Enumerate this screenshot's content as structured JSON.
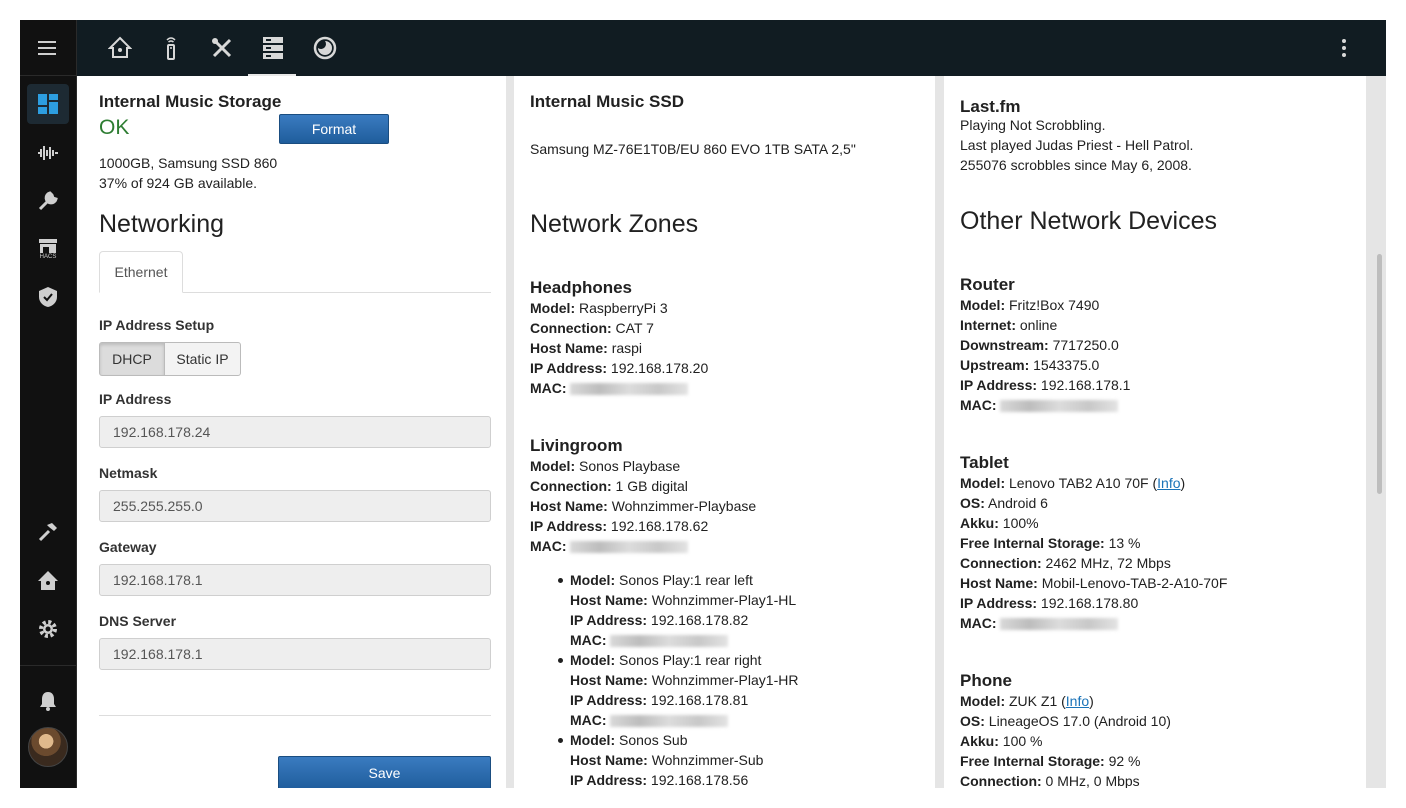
{
  "topbar": {
    "tabs": [
      {
        "icon": "home-assistant-icon"
      },
      {
        "icon": "remote-icon"
      },
      {
        "icon": "tools-icon"
      },
      {
        "icon": "server-icon"
      },
      {
        "icon": "moon-icon"
      }
    ],
    "active_tab": 3
  },
  "sidebar": {
    "items": [
      "dashboard-icon",
      "waveform-icon",
      "wrench-icon",
      "hacs-icon",
      "shield-icon"
    ],
    "bottom_items": [
      "hammer-icon",
      "home-assistant-icon",
      "gear-icon",
      "bell-icon"
    ],
    "hacs_label": "HACS"
  },
  "storage": {
    "title": "Internal Music Storage",
    "status": "OK",
    "format_label": "Format",
    "line1": "1000GB, Samsung SSD 860",
    "line2": "37% of 924 GB available."
  },
  "networking": {
    "title": "Networking",
    "tab": "Ethernet",
    "ip_setup_label": "IP Address Setup",
    "dhcp_label": "DHCP",
    "static_label": "Static IP",
    "fields": [
      {
        "label": "IP Address",
        "value": "192.168.178.24"
      },
      {
        "label": "Netmask",
        "value": "255.255.255.0"
      },
      {
        "label": "Gateway",
        "value": "192.168.178.1"
      },
      {
        "label": "DNS Server",
        "value": "192.168.178.1"
      }
    ],
    "save_label": "Save"
  },
  "ssd": {
    "title": "Internal Music SSD",
    "model": "Samsung MZ-76E1T0B/EU 860 EVO 1TB SATA 2,5\""
  },
  "labels": {
    "model": "Model:",
    "connection": "Connection:",
    "host": "Host Name:",
    "ip": "IP Address:",
    "mac": "MAC:",
    "internet": "Internet:",
    "downstream": "Downstream:",
    "upstream": "Upstream:",
    "os": "OS:",
    "akku": "Akku:",
    "storage": "Free Internal Storage:"
  },
  "zones": {
    "title": "Network Zones",
    "headphones": {
      "name": "Headphones",
      "model": "RaspberryPi 3",
      "connection": "CAT 7",
      "host": "raspi",
      "ip": "192.168.178.20"
    },
    "livingroom": {
      "name": "Livingroom",
      "model": "Sonos Playbase",
      "connection": "1 GB digital",
      "host": "Wohnzimmer-Playbase",
      "ip": "192.168.178.62",
      "subs": [
        {
          "model": "Sonos Play:1 rear left",
          "host": "Wohnzimmer-Play1-HL",
          "ip": "192.168.178.82"
        },
        {
          "model": "Sonos Play:1 rear right",
          "host": "Wohnzimmer-Play1-HR",
          "ip": "192.168.178.81"
        },
        {
          "model": "Sonos Sub",
          "host": "Wohnzimmer-Sub",
          "ip": "192.168.178.56"
        }
      ]
    }
  },
  "lastfm": {
    "title": "Last.fm",
    "line1": "Playing Not Scrobbling.",
    "line2": "Last played Judas Priest - Hell Patrol.",
    "line3": "255076 scrobbles since May 6, 2008."
  },
  "devices": {
    "title": "Other Network Devices",
    "router": {
      "name": "Router",
      "model": "Fritz!Box 7490",
      "internet": "online",
      "downstream": "7717250.0",
      "upstream": "1543375.0",
      "ip": "192.168.178.1"
    },
    "tablet": {
      "name": "Tablet",
      "model": "Lenovo TAB2 A10 70F (",
      "info": "Info",
      "close": ")",
      "os": "Android 6",
      "akku": "100%",
      "storage": "13 %",
      "connection": "2462 MHz, 72 Mbps",
      "host": "Mobil-Lenovo-TAB-2-A10-70F",
      "ip": "192.168.178.80"
    },
    "phone": {
      "name": "Phone",
      "model": "ZUK Z1 (",
      "info": "Info",
      "close": ")",
      "os": "LineageOS 17.0 (Android 10)",
      "akku": "100 %",
      "storage": "92 %",
      "connection": "0 MHz, 0 Mbps"
    }
  }
}
